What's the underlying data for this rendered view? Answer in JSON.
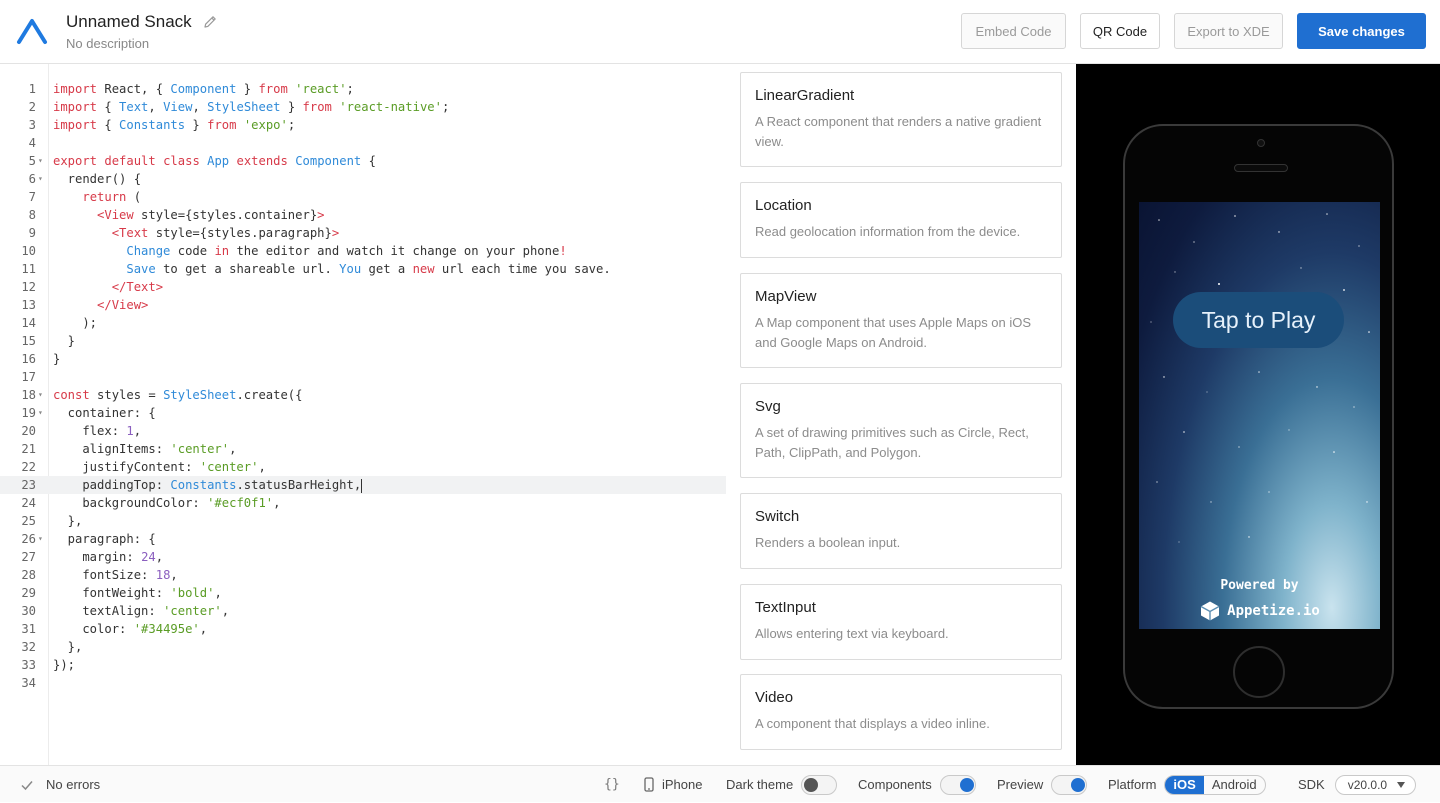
{
  "header": {
    "title": "Unnamed Snack",
    "description": "No description",
    "buttons": {
      "embed": "Embed Code",
      "qr": "QR Code",
      "export": "Export to XDE",
      "save": "Save changes"
    }
  },
  "editor": {
    "active_line": 23,
    "lines": [
      {
        "n": "1"
      },
      {
        "n": "2"
      },
      {
        "n": "3"
      },
      {
        "n": "4"
      },
      {
        "n": "5"
      },
      {
        "n": "6"
      },
      {
        "n": "7"
      },
      {
        "n": "8"
      },
      {
        "n": "9"
      },
      {
        "n": "10"
      },
      {
        "n": "11"
      },
      {
        "n": "12"
      },
      {
        "n": "13"
      },
      {
        "n": "14"
      },
      {
        "n": "15"
      },
      {
        "n": "16"
      },
      {
        "n": "17"
      },
      {
        "n": "18"
      },
      {
        "n": "19"
      },
      {
        "n": "20"
      },
      {
        "n": "21"
      },
      {
        "n": "22"
      },
      {
        "n": "23"
      },
      {
        "n": "24"
      },
      {
        "n": "25"
      },
      {
        "n": "26"
      },
      {
        "n": "27"
      },
      {
        "n": "28"
      },
      {
        "n": "29"
      },
      {
        "n": "30"
      },
      {
        "n": "31"
      },
      {
        "n": "32"
      },
      {
        "n": "33"
      },
      {
        "n": "34"
      }
    ],
    "code": {
      "l1": [
        "import",
        " React, { ",
        "Component",
        " } ",
        "from",
        " ",
        "'react'",
        ";"
      ],
      "l2": [
        "import",
        " { ",
        "Text",
        ", ",
        "View",
        ", ",
        "StyleSheet",
        " } ",
        "from",
        " ",
        "'react-native'",
        ";"
      ],
      "l3": [
        "import",
        " { ",
        "Constants",
        " } ",
        "from",
        " ",
        "'expo'",
        ";"
      ],
      "l5": [
        "export",
        " ",
        "default",
        " ",
        "class",
        " ",
        "App",
        " ",
        "extends",
        " ",
        "Component",
        " {"
      ],
      "l6": [
        "  render() {"
      ],
      "l7": [
        "    ",
        "return",
        " ("
      ],
      "l8": [
        "      ",
        "<View",
        " style={styles.container}",
        ">"
      ],
      "l9": [
        "        ",
        "<Text",
        " style={styles.paragraph}",
        ">"
      ],
      "l10": [
        "          ",
        "Change",
        " code ",
        "in",
        " the editor and watch it change on your phone",
        "!"
      ],
      "l11": [
        "          ",
        "Save",
        " to get a shareable url. ",
        "You",
        " get a ",
        "new",
        " url each time you save."
      ],
      "l12": [
        "        ",
        "</Text>"
      ],
      "l13": [
        "      ",
        "</View>"
      ],
      "l14": [
        "    );"
      ],
      "l15": [
        "  }"
      ],
      "l16": [
        "}"
      ],
      "l18": [
        "const",
        " styles = ",
        "StyleSheet",
        ".create({"
      ],
      "l19": [
        "  container: {"
      ],
      "l20": [
        "    flex: ",
        "1",
        ","
      ],
      "l21": [
        "    alignItems: ",
        "'center'",
        ","
      ],
      "l22": [
        "    justifyContent: ",
        "'center'",
        ","
      ],
      "l23": [
        "    paddingTop: ",
        "Constants",
        ".statusBarHeight,"
      ],
      "l24": [
        "    backgroundColor: ",
        "'#ecf0f1'",
        ","
      ],
      "l25": [
        "  },"
      ],
      "l26": [
        "  paragraph: {"
      ],
      "l27": [
        "    margin: ",
        "24",
        ","
      ],
      "l28": [
        "    fontSize: ",
        "18",
        ","
      ],
      "l29": [
        "    fontWeight: ",
        "'bold'",
        ","
      ],
      "l30": [
        "    textAlign: ",
        "'center'",
        ","
      ],
      "l31": [
        "    color: ",
        "'#34495e'",
        ","
      ],
      "l32": [
        "  },"
      ],
      "l33": [
        "});"
      ]
    }
  },
  "components": [
    {
      "title": "LinearGradient",
      "desc": "A React component that renders a native gradient view."
    },
    {
      "title": "Location",
      "desc": "Read geolocation information from the device."
    },
    {
      "title": "MapView",
      "desc": "A Map component that uses Apple Maps on iOS and Google Maps on Android."
    },
    {
      "title": "Svg",
      "desc": "A set of drawing primitives such as Circle, Rect, Path, ClipPath, and Polygon."
    },
    {
      "title": "Switch",
      "desc": "Renders a boolean input."
    },
    {
      "title": "TextInput",
      "desc": "Allows entering text via keyboard."
    },
    {
      "title": "Video",
      "desc": "A component that displays a video inline."
    }
  ],
  "preview": {
    "tap_to_play": "Tap to Play",
    "powered_by": "Powered by",
    "appetize": "Appetize.io"
  },
  "footer": {
    "errors": "No errors",
    "braces": "{}",
    "device": "iPhone",
    "dark_theme": "Dark theme",
    "dark_theme_on": false,
    "components": "Components",
    "components_on": true,
    "preview": "Preview",
    "preview_on": true,
    "platform": "Platform",
    "platform_ios": "iOS",
    "platform_android": "Android",
    "platform_selected": "iOS",
    "sdk": "SDK",
    "sdk_version": "v20.0.0"
  },
  "colors": {
    "accent": "#1f6fd1",
    "keyword": "#d73a49",
    "type": "#2f8ad8",
    "string": "#5a9c25",
    "number": "#8b5fbf"
  }
}
